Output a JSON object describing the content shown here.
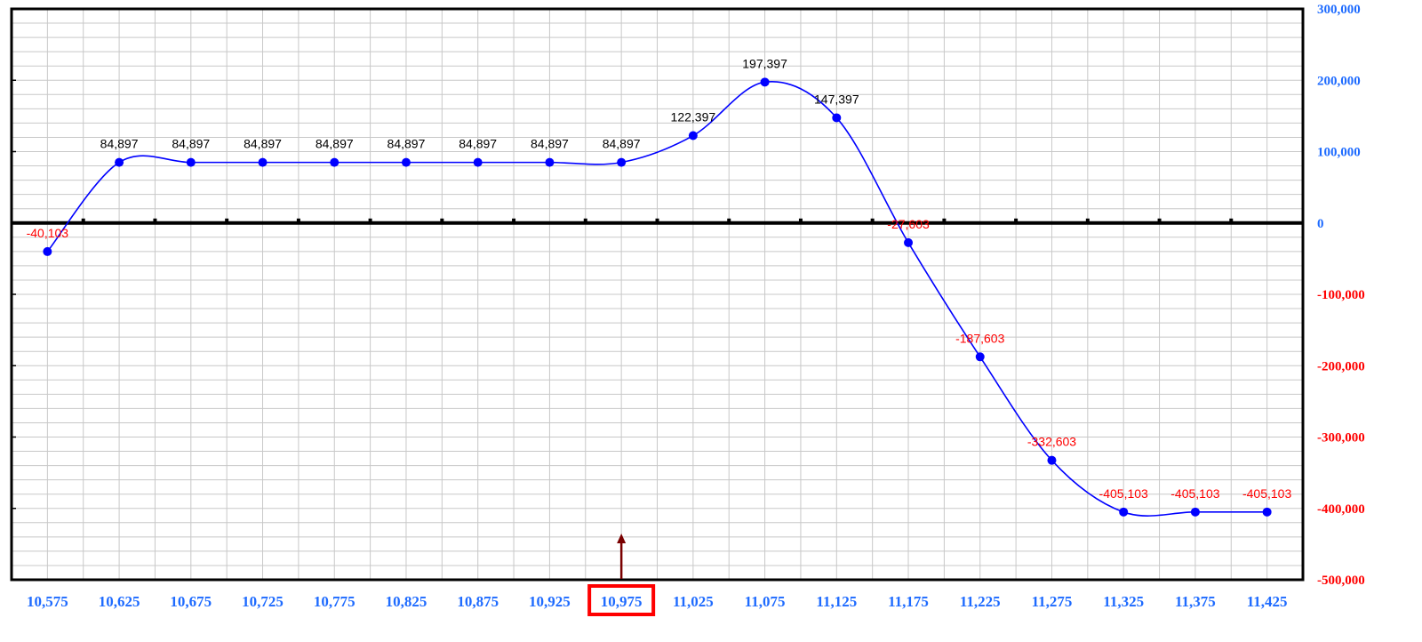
{
  "chart_data": {
    "type": "line",
    "x": [
      "10,575",
      "10,625",
      "10,675",
      "10,725",
      "10,775",
      "10,825",
      "10,875",
      "10,925",
      "10,975",
      "11,025",
      "11,075",
      "11,125",
      "11,175",
      "11,225",
      "11,275",
      "11,325",
      "11,375",
      "11,425"
    ],
    "series": [
      {
        "values": [
          -40103,
          84897,
          84897,
          84897,
          84897,
          84897,
          84897,
          84897,
          84897,
          122397,
          197397,
          147397,
          -27603,
          -187603,
          -332603,
          -405103,
          -405103,
          -405103
        ],
        "labels": [
          "-40,103",
          "84,897",
          "84,897",
          "84,897",
          "84,897",
          "84,897",
          "84,897",
          "84,897",
          "84,897",
          "122,397",
          "197,397",
          "147,397",
          "-27,603",
          "-187,603",
          "-332,603",
          "-405,103",
          "-405,103",
          "-405,103"
        ]
      }
    ],
    "y_ticks": [
      {
        "value": 300000,
        "label": "300,000"
      },
      {
        "value": 200000,
        "label": "200,000"
      },
      {
        "value": 100000,
        "label": "100,000"
      },
      {
        "value": 0,
        "label": "0"
      },
      {
        "value": -100000,
        "label": "-100,000"
      },
      {
        "value": -200000,
        "label": "-200,000"
      },
      {
        "value": -300000,
        "label": "-300,000"
      },
      {
        "value": -400000,
        "label": "-400,000"
      },
      {
        "value": -500000,
        "label": "-500,000"
      }
    ],
    "ylim": [
      -500000,
      300000
    ],
    "grid": true,
    "highlighted_x": "10,975",
    "colors": {
      "line": "#0000ff",
      "positive_label": "#000000",
      "negative_label": "#ff0000",
      "positive_tick": "#1e6bff",
      "negative_tick": "#ff0000",
      "highlight_box": "#ff0000",
      "marker_arrow": "#7a0000",
      "grid": "#c8c8c8"
    }
  }
}
